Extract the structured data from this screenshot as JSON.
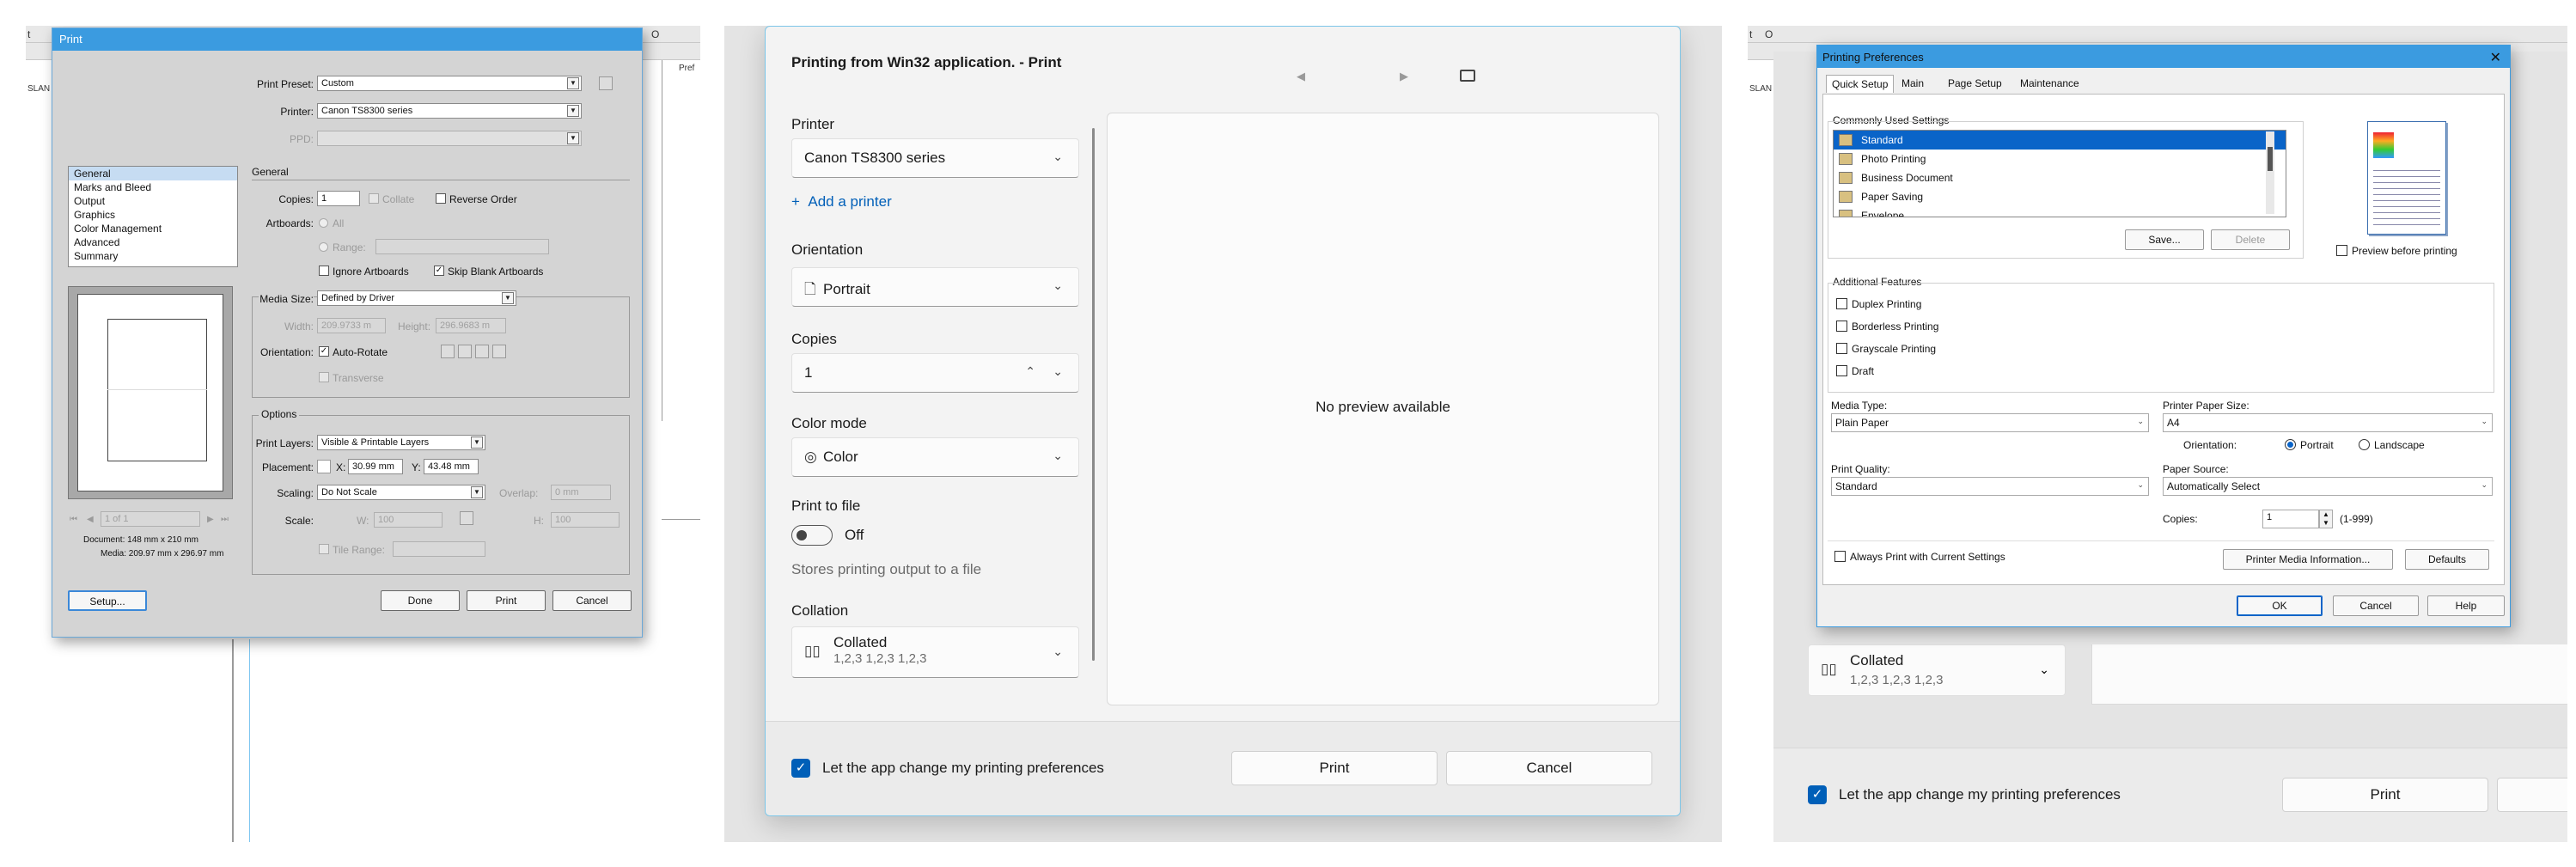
{
  "panel1": {
    "window_title": "Print",
    "print_preset_label": "Print Preset:",
    "print_preset_value": "Custom",
    "printer_label": "Printer:",
    "printer_value": "Canon TS8300 series",
    "ppd_label": "PPD:",
    "nav_items": [
      "General",
      "Marks and Bleed",
      "Output",
      "Graphics",
      "Color Management",
      "Advanced",
      "Summary"
    ],
    "general_section": "General",
    "copies_label": "Copies:",
    "copies_value": "1",
    "collate_label": "Collate",
    "reverse_order_label": "Reverse Order",
    "artboards_label": "Artboards:",
    "all_label": "All",
    "range_label": "Range:",
    "ignore_artboards_label": "Ignore Artboards",
    "skip_blank_label": "Skip Blank Artboards",
    "media_size_label": "Media Size:",
    "media_size_value": "Defined by Driver",
    "width_label": "Width:",
    "width_value": "209.9733 m",
    "height_label": "Height:",
    "height_value": "296.9683 m",
    "orientation_label": "Orientation:",
    "auto_rotate_label": "Auto-Rotate",
    "transverse_label": "Transverse",
    "options_section": "Options",
    "print_layers_label": "Print Layers:",
    "print_layers_value": "Visible & Printable Layers",
    "placement_label": "Placement:",
    "x_label": "X:",
    "x_value": "30.99 mm",
    "y_label": "Y:",
    "y_value": "43.48 mm",
    "scaling_label": "Scaling:",
    "scaling_value": "Do Not Scale",
    "overlap_label": "Overlap:",
    "overlap_value": "0 mm",
    "scale_label": "Scale:",
    "w_label": "W:",
    "w_value": "100",
    "h_label": "H:",
    "h_value": "100",
    "tile_range_label": "Tile Range:",
    "page_indicator": "1 of 1",
    "document_size": "Document: 148 mm x 210 mm",
    "media_size_info": "Media: 209.97 mm x 296.97 mm",
    "setup_button": "Setup...",
    "done_button": "Done",
    "print_button": "Print",
    "cancel_button": "Cancel",
    "behind_text_a": "t",
    "behind_text_b": "O",
    "behind_text_c": "SLAN",
    "behind_text_d": "Pref"
  },
  "panel2": {
    "title": "Printing from Win32 application. - Print",
    "printer_label": "Printer",
    "printer_value": "Canon TS8300 series",
    "add_printer": "Add a printer",
    "orientation_label": "Orientation",
    "orientation_value": "Portrait",
    "copies_label": "Copies",
    "copies_value": "1",
    "color_mode_label": "Color mode",
    "color_mode_value": "Color",
    "print_to_file_label": "Print to file",
    "print_to_file_state": "Off",
    "print_to_file_desc": "Stores printing output to a file",
    "collation_label": "Collation",
    "collation_value": "Collated",
    "collation_sub": "1,2,3  1,2,3  1,2,3",
    "no_preview": "No preview available",
    "app_prefs_label": "Let the app change my printing preferences",
    "print_button": "Print",
    "cancel_button": "Cancel",
    "accent_color": "#005fb8"
  },
  "panel3": {
    "window_title": "Printing Preferences",
    "tabs": [
      "Quick Setup",
      "Main",
      "Page Setup",
      "Maintenance"
    ],
    "common_settings_label": "Commonly Used Settings",
    "settings_items": [
      "Standard",
      "Photo Printing",
      "Business Document",
      "Paper Saving",
      "Envelope"
    ],
    "save_button": "Save...",
    "delete_button": "Delete",
    "preview_before_label": "Preview before printing",
    "additional_features_label": "Additional Features",
    "features": [
      "Duplex Printing",
      "Borderless Printing",
      "Grayscale Printing",
      "Draft"
    ],
    "media_type_label": "Media Type:",
    "media_type_value": "Plain Paper",
    "printer_paper_size_label": "Printer Paper Size:",
    "paper_size_value": "A4",
    "orientation_label": "Orientation:",
    "portrait_label": "Portrait",
    "landscape_label": "Landscape",
    "print_quality_label": "Print Quality:",
    "print_quality_value": "Standard",
    "paper_source_label": "Paper Source:",
    "paper_source_value": "Automatically Select",
    "copies_label": "Copies:",
    "copies_value": "1",
    "copies_range": "(1-999)",
    "always_print_label": "Always Print with Current Settings",
    "media_info_button": "Printer Media Information...",
    "defaults_button": "Defaults",
    "ok_button": "OK",
    "cancel_button": "Cancel",
    "help_button": "Help",
    "bg_collation_value": "Collated",
    "bg_collation_sub": "1,2,3  1,2,3  1,2,3",
    "bg_app_prefs_label": "Let the app change my printing preferences",
    "bg_print_button": "Print",
    "behind_text_a": "t",
    "behind_text_b": "O",
    "behind_text_c": "SLAN"
  }
}
